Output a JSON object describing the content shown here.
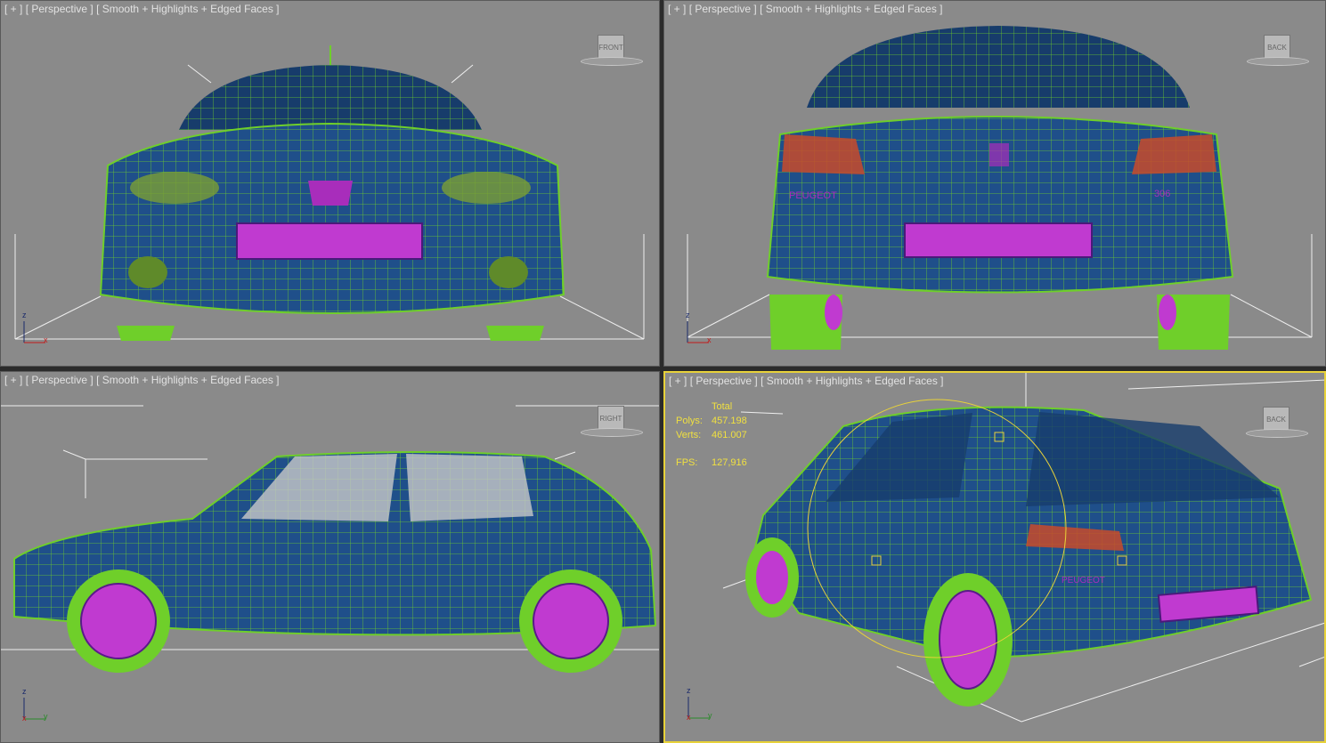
{
  "viewports": [
    {
      "id": "front",
      "label_plus": "[ + ]",
      "label_view": "[ Perspective ]",
      "label_mode": "[ Smooth + Highlights + Edged Faces ]",
      "cube_face": "FRONT",
      "active": false,
      "axes": [
        "z",
        "x"
      ]
    },
    {
      "id": "back",
      "label_plus": "[ + ]",
      "label_view": "[ Perspective ]",
      "label_mode": "[ Smooth + Highlights + Edged Faces ]",
      "cube_face": "BACK",
      "active": false,
      "axes": [
        "z",
        "x"
      ]
    },
    {
      "id": "right",
      "label_plus": "[ + ]",
      "label_view": "[ Perspective ]",
      "label_mode": "[ Smooth + Highlights + Edged Faces ]",
      "cube_face": "RIGHT",
      "active": false,
      "axes": [
        "z",
        "x",
        "y"
      ]
    },
    {
      "id": "persp",
      "label_plus": "[ + ]",
      "label_view": "[ Perspective ]",
      "label_mode": "[ Smooth + Highlights + Edged Faces ]",
      "cube_face": "BACK",
      "active": true,
      "axes": [
        "z",
        "x",
        "y"
      ]
    }
  ],
  "stats": {
    "total": "Total",
    "polys_label": "Polys:",
    "polys": "457.198",
    "verts_label": "Verts:",
    "verts": "461.007",
    "fps_label": "FPS:",
    "fps": "127,916"
  },
  "colors": {
    "viewport_bg": "#8a8a8a",
    "wire": "#6fcf2a",
    "body": "#1f4f8a",
    "plate": "#c03ad0",
    "active_border": "#e8d23a"
  },
  "badges": {
    "brand": "PEUGEOT",
    "model": "306"
  }
}
